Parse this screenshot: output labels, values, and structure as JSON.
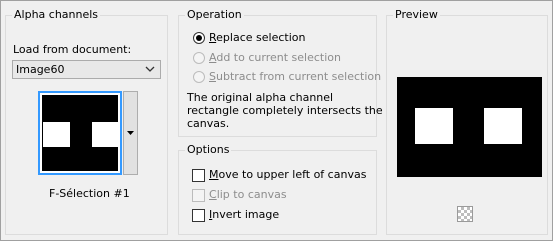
{
  "alpha_channels": {
    "title": "Alpha channels",
    "load_label": "Load from document:",
    "document_value": "Image60",
    "channel_name": "F-Sélection #1"
  },
  "operation": {
    "title": "Operation",
    "options": [
      {
        "label": "Replace selection",
        "selected": true,
        "enabled": true
      },
      {
        "label": "Add to current selection",
        "selected": false,
        "enabled": false
      },
      {
        "label": "Subtract from current selection",
        "selected": false,
        "enabled": false
      }
    ],
    "message_lines": [
      "The original alpha channel",
      "rectangle completely intersects the",
      "canvas."
    ]
  },
  "options": {
    "title": "Options",
    "items": [
      {
        "label": "Move to upper left of canvas",
        "checked": false,
        "enabled": true
      },
      {
        "label": "Clip to canvas",
        "checked": false,
        "enabled": false
      },
      {
        "label": "Invert image",
        "checked": false,
        "enabled": true
      }
    ]
  },
  "preview": {
    "title": "Preview"
  },
  "icons": {
    "dropdown_arrow": "chevron-down-icon",
    "thumb_dropdown": "triangle-down-icon",
    "transparency": "checkerboard-icon"
  }
}
